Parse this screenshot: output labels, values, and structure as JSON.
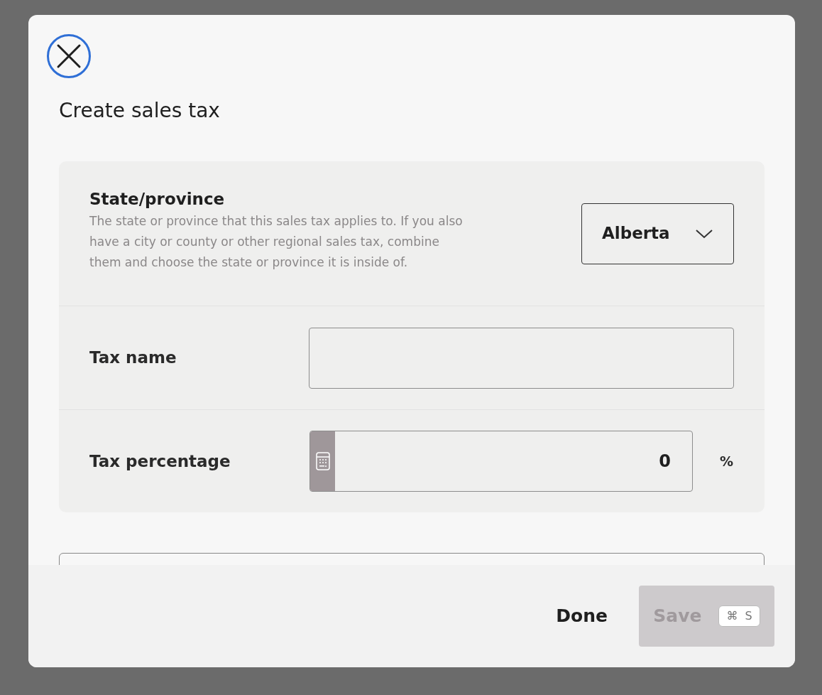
{
  "dialog": {
    "title": "Create sales tax"
  },
  "state_field": {
    "label": "State/province",
    "description": "The state or province that this sales tax applies to. If you also have a city or county or other regional sales tax, combine them and choose the state or province it is inside of.",
    "value": "Alberta"
  },
  "tax_name": {
    "label": "Tax name"
  },
  "tax_percentage": {
    "label": "Tax percentage",
    "value": "0",
    "unit": "%"
  },
  "footer": {
    "done": "Done",
    "save": {
      "label": "Save",
      "disabled": true,
      "shortcut_symbol": "⌘",
      "shortcut_key": "S"
    }
  }
}
